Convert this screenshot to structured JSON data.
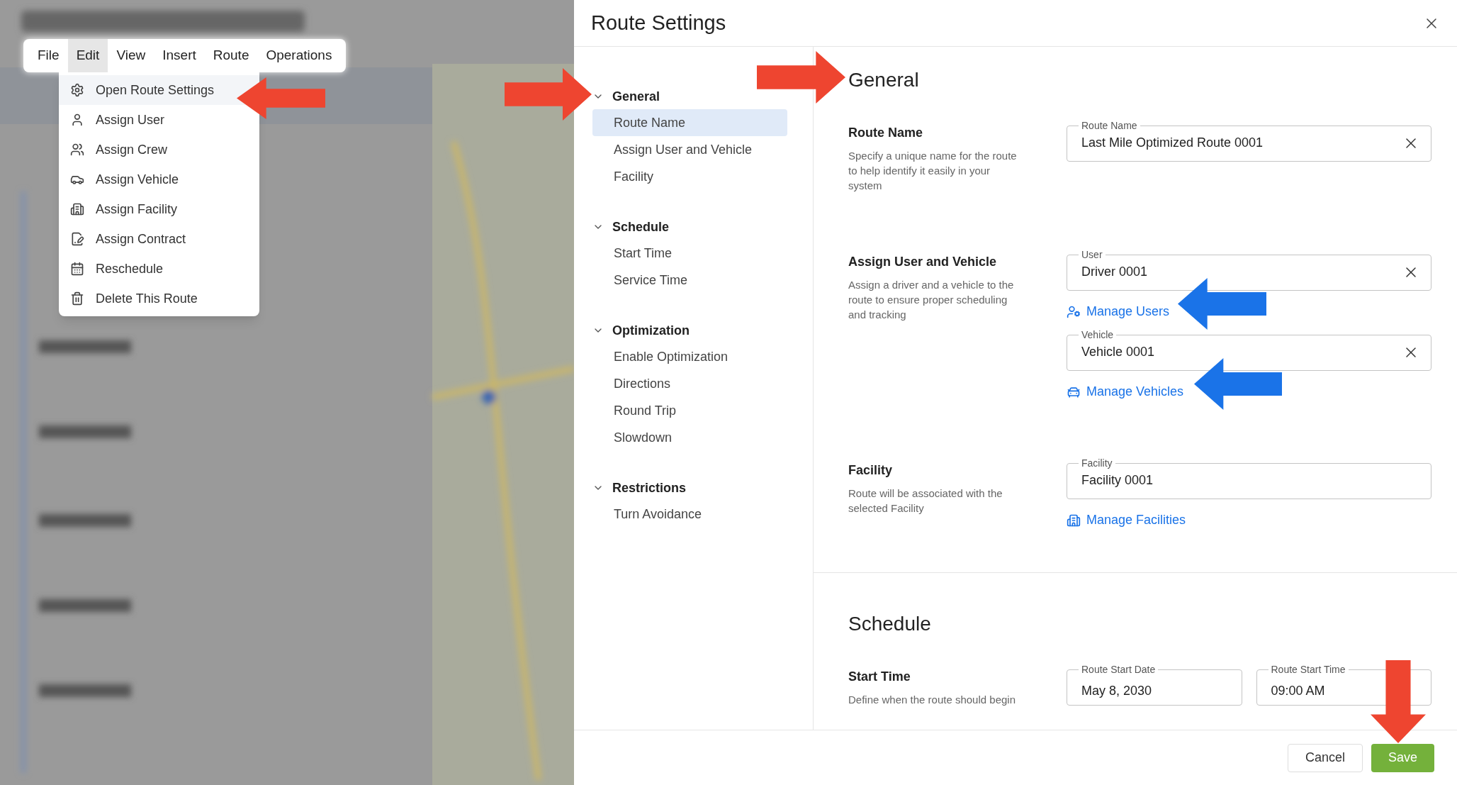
{
  "menu_bar": [
    {
      "label": "File",
      "selected": false
    },
    {
      "label": "Edit",
      "selected": true
    },
    {
      "label": "View",
      "selected": false
    },
    {
      "label": "Insert",
      "selected": false
    },
    {
      "label": "Route",
      "selected": false
    },
    {
      "label": "Operations",
      "selected": false
    }
  ],
  "edit_menu": [
    {
      "label": "Open Route Settings",
      "selected": true
    },
    {
      "label": "Assign User",
      "selected": false
    },
    {
      "label": "Assign Crew",
      "selected": false
    },
    {
      "label": "Assign Vehicle",
      "selected": false
    },
    {
      "label": "Assign Facility",
      "selected": false
    },
    {
      "label": "Assign Contract",
      "selected": false
    },
    {
      "label": "Reschedule",
      "selected": false
    },
    {
      "label": "Delete This Route",
      "selected": false
    }
  ],
  "dialog": {
    "title": "Route Settings",
    "nav": [
      {
        "label": "General",
        "expanded": true,
        "children": [
          {
            "label": "Route Name",
            "selected": true
          },
          {
            "label": "Assign User and Vehicle",
            "selected": false
          },
          {
            "label": "Facility",
            "selected": false
          }
        ]
      },
      {
        "label": "Schedule",
        "expanded": true,
        "children": [
          {
            "label": "Start Time",
            "selected": false
          },
          {
            "label": "Service Time",
            "selected": false
          }
        ]
      },
      {
        "label": "Optimization",
        "expanded": true,
        "children": [
          {
            "label": "Enable Optimization",
            "selected": false
          },
          {
            "label": "Directions",
            "selected": false
          },
          {
            "label": "Round Trip",
            "selected": false
          },
          {
            "label": "Slowdown",
            "selected": false
          }
        ]
      },
      {
        "label": "Restrictions",
        "expanded": true,
        "children": [
          {
            "label": "Turn Avoidance",
            "selected": false
          }
        ]
      }
    ],
    "sections": [
      {
        "title": "General",
        "rows": [
          {
            "title": "Route Name",
            "description": "Specify a unique name for the route to help identify it easily in your system",
            "items": [
              {
                "kind": "field",
                "label": "Route Name",
                "value": "Last Mile Optimized Route 0001",
                "clearable": true
              }
            ]
          },
          {
            "title": "Assign User and Vehicle",
            "description": "Assign a driver and a vehicle to the route to ensure proper scheduling and tracking",
            "items": [
              {
                "kind": "field",
                "label": "User",
                "value": "Driver 0001",
                "clearable": true
              },
              {
                "kind": "link",
                "label": "Manage Users"
              },
              {
                "kind": "field",
                "label": "Vehicle",
                "value": "Vehicle 0001",
                "clearable": true
              },
              {
                "kind": "link",
                "label": "Manage Vehicles"
              }
            ]
          },
          {
            "title": "Facility",
            "description": "Route will be associated with the selected Facility",
            "items": [
              {
                "kind": "field",
                "label": "Facility",
                "value": "Facility 0001",
                "clearable": false
              },
              {
                "kind": "link",
                "label": "Manage Facilities"
              }
            ]
          }
        ]
      },
      {
        "title": "Schedule",
        "rows": [
          {
            "title": "Start Time",
            "description": "Define when the route should begin",
            "items": [
              {
                "kind": "field",
                "label": "Route Start Date",
                "value": "May 8, 2030",
                "clearable": false
              },
              {
                "kind": "field",
                "label": "Route Start Time",
                "value": "09:00 AM",
                "clearable": false
              }
            ]
          }
        ]
      }
    ],
    "buttons": [
      {
        "label": "Cancel",
        "kind": "secondary"
      },
      {
        "label": "Save",
        "kind": "primary"
      }
    ]
  }
}
